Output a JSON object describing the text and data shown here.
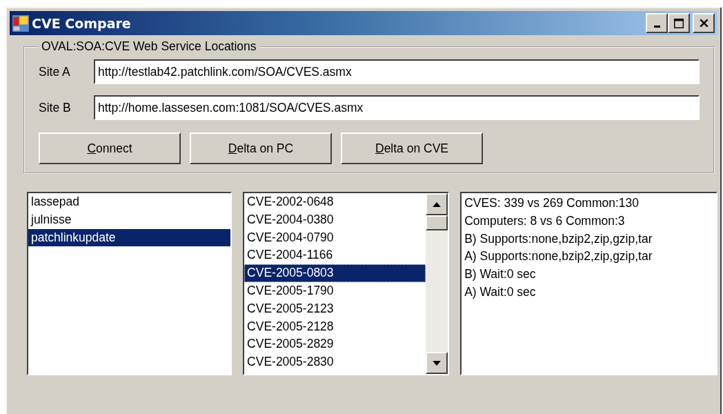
{
  "window": {
    "title": "CVE Compare"
  },
  "group": {
    "title": "OVAL:SOA:CVE Web Service Locations",
    "sites": [
      {
        "label": "Site A",
        "value": "http://testlab42.patchlink.com/SOA/CVES.asmx"
      },
      {
        "label": "Site B",
        "value": "http://home.lassesen.com:1081/SOA/CVES.asmx"
      }
    ],
    "buttons": [
      "Connect",
      "Delta on PC",
      "Delta on CVE"
    ]
  },
  "computers": [
    {
      "label": "lassepad",
      "selected": false
    },
    {
      "label": "julnisse",
      "selected": false
    },
    {
      "label": "patchlinkupdate",
      "selected": true
    }
  ],
  "cves": [
    {
      "label": "CVE-2002-0648",
      "selected": false
    },
    {
      "label": "CVE-2004-0380",
      "selected": false
    },
    {
      "label": "CVE-2004-0790",
      "selected": false
    },
    {
      "label": "CVE-2004-1166",
      "selected": false
    },
    {
      "label": "CVE-2005-0803",
      "selected": true
    },
    {
      "label": "CVE-2005-1790",
      "selected": false
    },
    {
      "label": "CVE-2005-2123",
      "selected": false
    },
    {
      "label": "CVE-2005-2128",
      "selected": false
    },
    {
      "label": "CVE-2005-2829",
      "selected": false
    },
    {
      "label": "CVE-2005-2830",
      "selected": false
    }
  ],
  "results": [
    "CVES: 339 vs 269 Common:130",
    "Computers: 8 vs 6 Common:3",
    "B) Supports:none,bzip2,zip,gzip,tar",
    "A) Supports:none,bzip2,zip,gzip,tar",
    "B) Wait:0 sec",
    "A) Wait:0 sec"
  ]
}
